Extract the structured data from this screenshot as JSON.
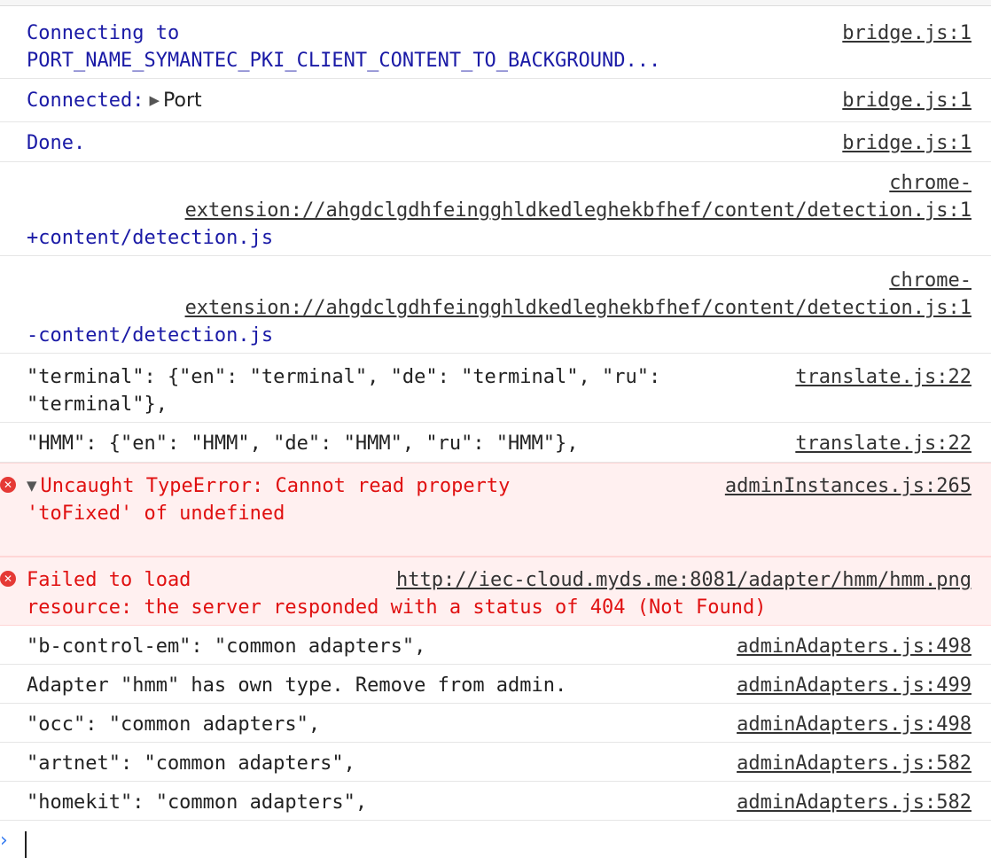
{
  "messages": [
    {
      "lines": [
        "Connecting to",
        "PORT_NAME_SYMANTEC_PKI_CLIENT_CONTENT_TO_BACKGROUND..."
      ],
      "source": "bridge.js:1"
    },
    {
      "text": "Connected:",
      "object": "Port",
      "source": "bridge.js:1"
    },
    {
      "text": "Done.",
      "source": "bridge.js:1"
    },
    {
      "source_lines": [
        "chrome-",
        "extension://ahgdclgdhfeingghldkedleghekbfhef/content/detection.js:1"
      ],
      "text": "+content/detection.js"
    },
    {
      "source_lines": [
        "chrome-",
        "extension://ahgdclgdhfeingghldkedleghekbfhef/content/detection.js:1"
      ],
      "text": "-content/detection.js"
    },
    {
      "lines": [
        "\"terminal\": {\"en\": \"terminal\", \"de\": \"terminal\", \"ru\":",
        "\"terminal\"},"
      ],
      "source": "translate.js:22"
    },
    {
      "text": "\"HMM\": {\"en\": \"HMM\", \"de\": \"HMM\", \"ru\": \"HMM\"},",
      "source": "translate.js:22"
    },
    {
      "level": "error",
      "lines": [
        "Uncaught TypeError: Cannot read property",
        "'toFixed' of undefined"
      ],
      "source": "adminInstances.js:265"
    },
    {
      "level": "error",
      "prefix": "Failed to load",
      "url": "http://iec-cloud.myds.me:8081/adapter/hmm/hmm.png",
      "line2": "resource: the server responded with a status of 404 (Not Found)"
    },
    {
      "text": "\"b-control-em\": \"common adapters\",",
      "source": "adminAdapters.js:498"
    },
    {
      "text": "Adapter \"hmm\" has own type. Remove from admin.",
      "source": "adminAdapters.js:499"
    },
    {
      "text": "\"occ\": \"common adapters\",",
      "source": "adminAdapters.js:498"
    },
    {
      "text": "\"artnet\": \"common adapters\",",
      "source": "adminAdapters.js:582"
    },
    {
      "text": "\"homekit\": \"common adapters\",",
      "source": "adminAdapters.js:582"
    }
  ],
  "icons": {
    "error": "error-circle-icon",
    "expand_open": "triangle-down-icon",
    "expand_closed": "triangle-right-icon",
    "prompt": "chevron-right-icon"
  },
  "colors": {
    "info_text": "#1a1aa6",
    "error_text": "#e01010",
    "error_bg": "#fff0f0",
    "prompt": "#367cf1"
  }
}
